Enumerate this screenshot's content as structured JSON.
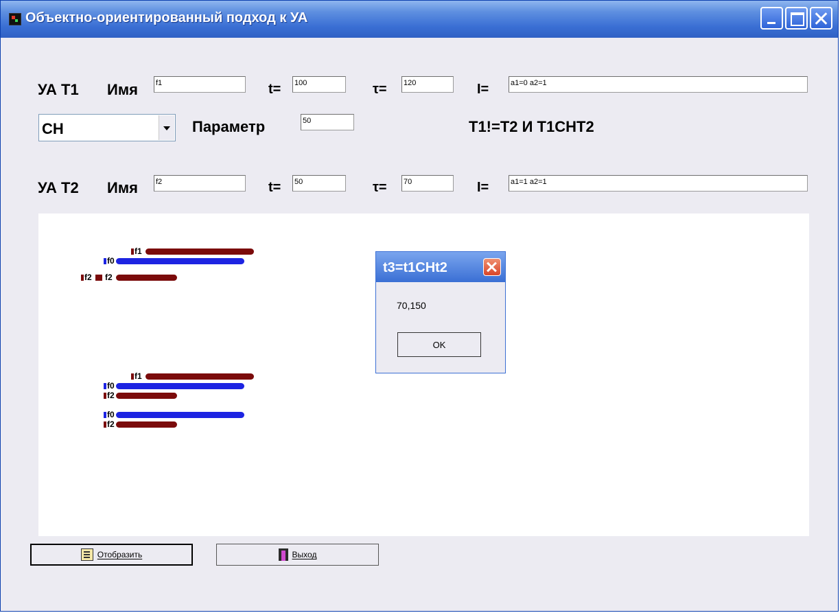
{
  "window": {
    "title": "Объектно-ориентированный подход к УА"
  },
  "t1": {
    "label": "УА Т1",
    "name_label": "Имя",
    "name_value": "f1",
    "t_label": "t=",
    "t_value": "100",
    "tau_label": "τ=",
    "tau_value": "120",
    "i_label": "I=",
    "i_value": "a1=0 a2=1"
  },
  "op": {
    "combo_value": "СН",
    "param_label": "Параметр",
    "param_value": "50",
    "result_text": "T1!=T2 И T1CHT2"
  },
  "t2": {
    "label": "УА Т2",
    "name_label": "Имя",
    "name_value": "f2",
    "t_label": "t=",
    "t_value": "50",
    "tau_label": "τ=",
    "tau_value": "70",
    "i_label": "I=",
    "i_value": "a1=1 a2=1"
  },
  "diagram": {
    "labels": {
      "g1_f1": "f1",
      "g1_f0": "f0",
      "g1_f2a": "f2",
      "g1_f2b": "f2",
      "g2_f1": "f1",
      "g2_f0": "f0",
      "g2_f2": "f2",
      "g3_f0": "f0",
      "g3_f2": "f2"
    },
    "colors": {
      "red": "#7b0b0b",
      "blue": "#1d24e2"
    }
  },
  "buttons": {
    "display_label": "Отобразить",
    "exit_label": "Выход"
  },
  "dialog": {
    "title": "t3=t1CHt2",
    "message": "70,150",
    "ok_label": "OK"
  }
}
